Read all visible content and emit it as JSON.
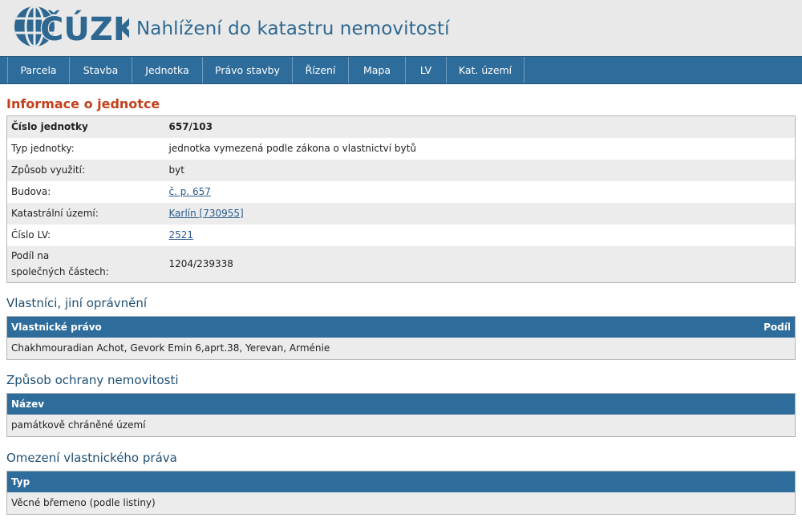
{
  "header": {
    "logo_text": "ČÚZK",
    "title": "Nahlížení do katastru nemovitostí"
  },
  "nav": {
    "items": [
      {
        "label": "Parcela",
        "w": 78
      },
      {
        "label": "Stavba",
        "w": 78
      },
      {
        "label": "Jednotka",
        "w": 88
      },
      {
        "label": "Právo stavby",
        "w": 112
      },
      {
        "label": "Řízení",
        "w": 70
      },
      {
        "label": "Mapa",
        "w": 71
      },
      {
        "label": "LV",
        "w": 51
      },
      {
        "label": "Kat. území",
        "w": 97
      }
    ]
  },
  "unit_info": {
    "title": "Informace o jednotce",
    "rows": {
      "cislo_jednotky": {
        "label": "Číslo jednotky",
        "value": "657/103"
      },
      "typ_jednotky": {
        "label": "Typ jednotky:",
        "value": "jednotka vymezená podle zákona o vlastnictví bytů"
      },
      "zpusob_vyuziti": {
        "label": "Způsob využití:",
        "value": "byt"
      },
      "budova": {
        "label": "Budova:",
        "value": "č. p. 657"
      },
      "katastralni_uzemi": {
        "label": "Katastrální území:",
        "value": "Karlín [730955]"
      },
      "cislo_lv": {
        "label": "Číslo LV:",
        "value": "2521"
      },
      "podil": {
        "label_line1": "Podíl na",
        "label_line2": "společných částech:",
        "value": "1204/239338"
      }
    }
  },
  "owners": {
    "title": "Vlastníci, jiní oprávnění",
    "col_right": "Vlastnické právo",
    "col_share": "Podíl",
    "rows": [
      {
        "name": "Chakhmouradian Achot, Gevork Emin 6,aprt.38, Yerevan, Arménie",
        "share": ""
      }
    ]
  },
  "protection": {
    "title": "Způsob ochrany nemovitosti",
    "col_name": "Název",
    "rows": [
      {
        "name": "památkově chráněné území"
      }
    ]
  },
  "restrictions": {
    "title": "Omezení vlastnického práva",
    "col_type": "Typ",
    "rows": [
      {
        "type": "Věcné břemeno (podle listiny)"
      }
    ]
  },
  "colors": {
    "nav_bg": "#2e6c9b",
    "heading_accent": "#c2401c",
    "heading_secondary": "#1f4f75",
    "link": "#2a5a8c"
  }
}
